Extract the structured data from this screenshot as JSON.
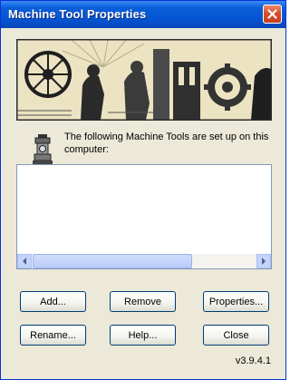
{
  "window": {
    "title": "Machine Tool Properties"
  },
  "banner": {
    "image": "industrial-machinery-illustration"
  },
  "info": {
    "icon": "machine-tool-icon",
    "text": "The following Machine Tools are set up on this computer:"
  },
  "list": {
    "items": []
  },
  "buttons": {
    "add": "Add...",
    "remove": "Remove",
    "properties": "Properties...",
    "rename": "Rename...",
    "help": "Help...",
    "close": "Close"
  },
  "version": "v3.9.4.1",
  "colors": {
    "titlebar": "#0553d1",
    "close_button": "#d94f2b",
    "dialog_background": "#ece9d8",
    "button_border": "#003c74"
  }
}
